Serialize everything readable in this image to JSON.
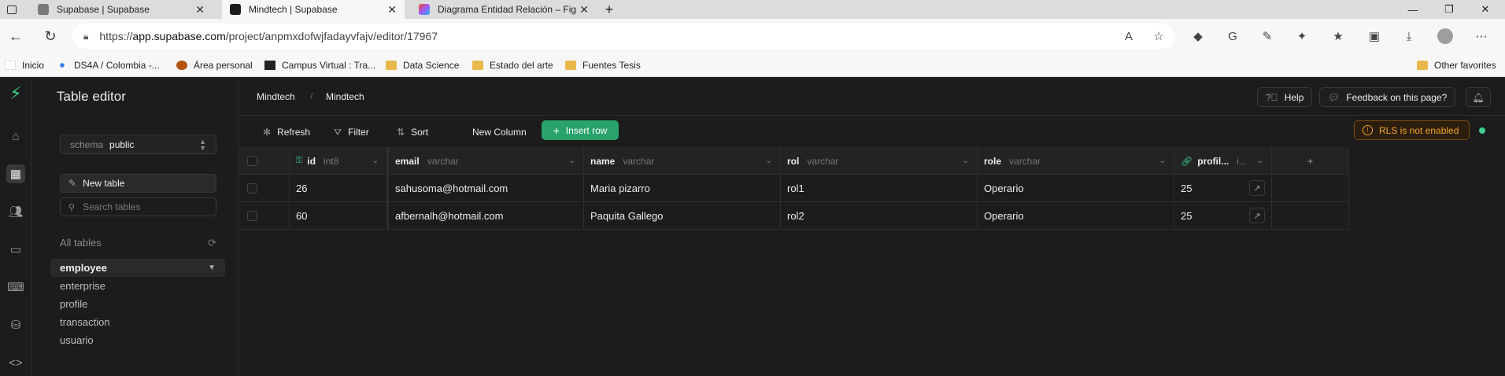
{
  "browser": {
    "tabs": [
      {
        "title": "Supabase | Supabase"
      },
      {
        "title": "Mindtech | Supabase"
      },
      {
        "title": "Diagrama Entidad Relación – Fig"
      }
    ],
    "url_prefix": "https://",
    "url_host": "app.supabase.com",
    "url_path": "/project/anpmxdofwjfadayvfajv/editor/17967",
    "bookmarks": [
      {
        "label": "Inicio"
      },
      {
        "label": "DS4A / Colombia -..."
      },
      {
        "label": "Área personal"
      },
      {
        "label": "Campus Virtual : Tra..."
      },
      {
        "label": "Data Science"
      },
      {
        "label": "Estado del arte"
      },
      {
        "label": "Fuentes Tesis"
      }
    ],
    "other_favorites": "Other favorites"
  },
  "sidebar": {
    "title": "Table editor",
    "schema_label": "schema",
    "schema_value": "public",
    "new_table": "New table",
    "search_placeholder": "Search tables",
    "all_tables": "All tables",
    "tables": [
      {
        "label": "employee"
      },
      {
        "label": "enterprise"
      },
      {
        "label": "profile"
      },
      {
        "label": "transaction"
      },
      {
        "label": "usuario"
      }
    ]
  },
  "topbar": {
    "breadcrumb": [
      "Mindtech",
      "Mindtech"
    ],
    "help": "Help",
    "feedback": "Feedback on this page?"
  },
  "toolbar": {
    "refresh": "Refresh",
    "filter": "Filter",
    "sort": "Sort",
    "new_column": "New Column",
    "insert_row": "Insert row",
    "rls_warning": "RLS is not enabled"
  },
  "grid": {
    "columns": [
      {
        "name": "id",
        "type": "int8"
      },
      {
        "name": "email",
        "type": "varchar"
      },
      {
        "name": "name",
        "type": "varchar"
      },
      {
        "name": "rol",
        "type": "varchar"
      },
      {
        "name": "role",
        "type": "varchar"
      },
      {
        "name": "profil...",
        "type": "i..."
      }
    ],
    "rows": [
      {
        "id": "26",
        "email": "sahusoma@hotmail.com",
        "name": "Maria pizarro",
        "rol": "rol1",
        "role": "Operario",
        "profile": "25"
      },
      {
        "id": "60",
        "email": "afbernalh@hotmail.com",
        "name": "Paquita Gallego",
        "rol": "rol2",
        "role": "Operario",
        "profile": "25"
      }
    ]
  },
  "colors": {
    "brand_green": "#3ecf8e",
    "warning": "#f5a524"
  }
}
